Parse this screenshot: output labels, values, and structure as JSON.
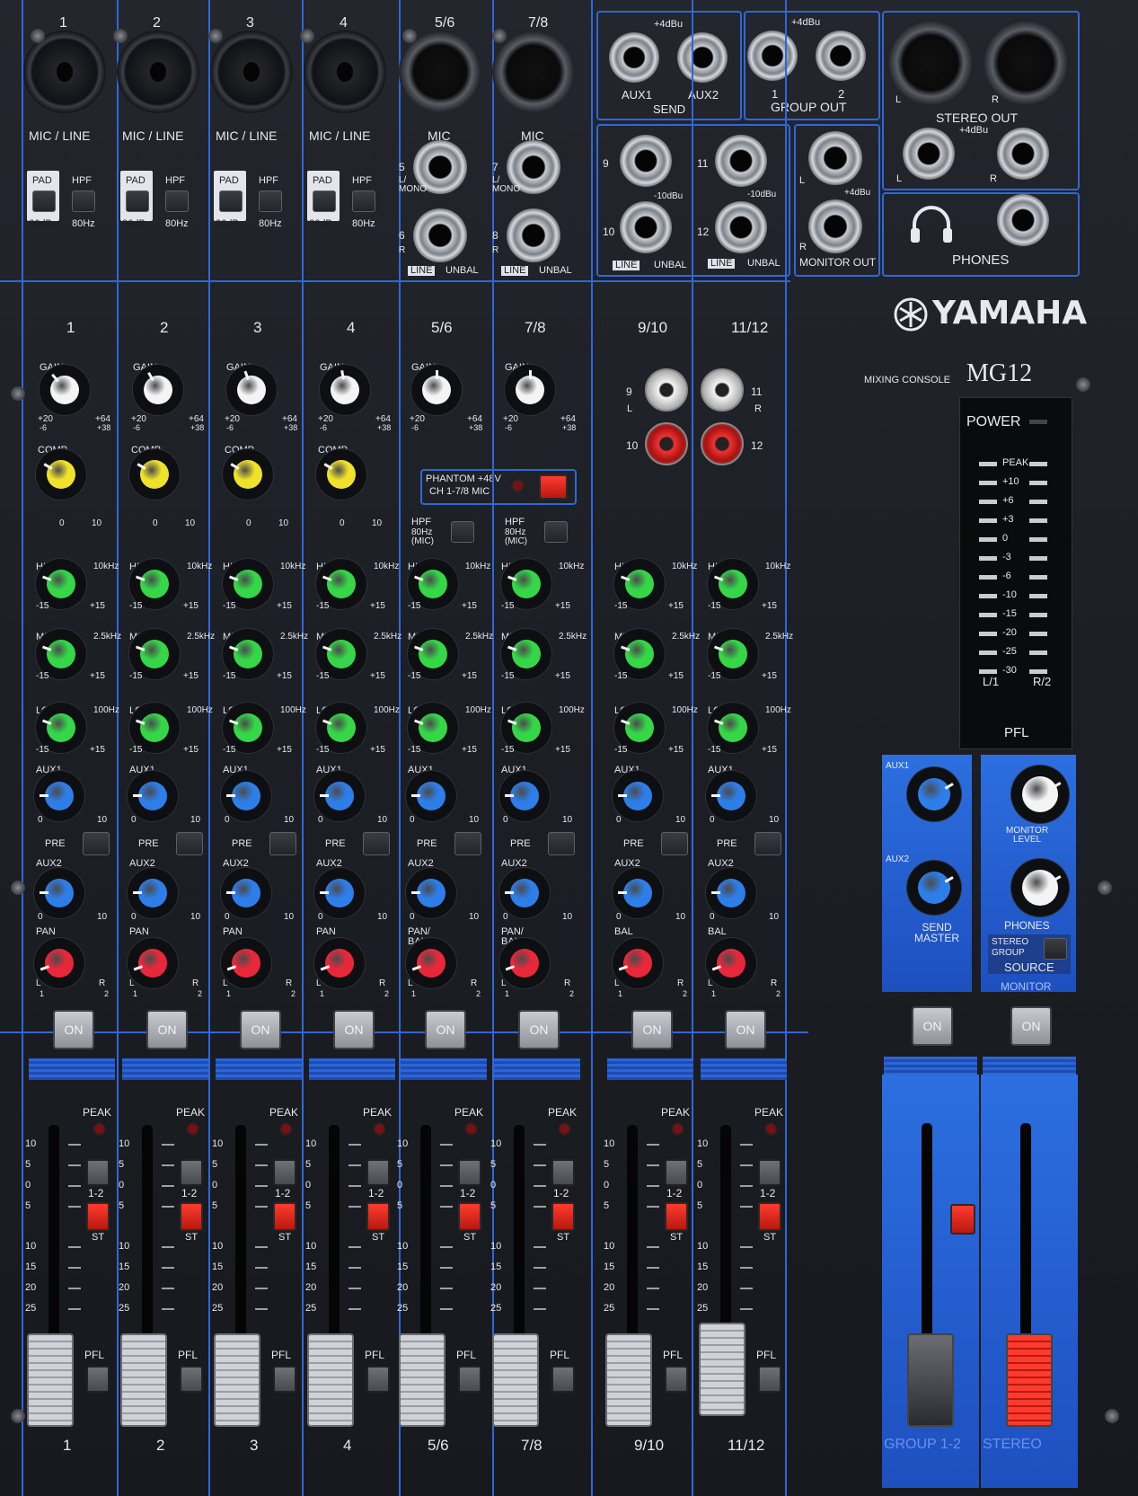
{
  "brand": {
    "logo": "YAMAHA",
    "model_prefix": "MIXING CONSOLE",
    "model": "MG12"
  },
  "top_inputs": {
    "channel_numbers": [
      "1",
      "2",
      "3",
      "4",
      "5/6",
      "7/8"
    ],
    "input_labels": [
      "MIC / LINE",
      "MIC / LINE",
      "MIC / LINE",
      "MIC / LINE",
      "MIC",
      "MIC"
    ],
    "pad_label": "PAD",
    "pad_value": "26dB",
    "hpf_label": "HPF",
    "hpf_value": "80Hz",
    "stereo_jacks": {
      "ch56": {
        "top_num": "5",
        "top_sub": "L/\nMONO",
        "bottom_num": "6",
        "bottom_sub": "R"
      },
      "ch78": {
        "top_num": "7",
        "top_sub": "L/\nMONO",
        "bottom_num": "8",
        "bottom_sub": "R"
      },
      "line": "LINE",
      "unbal": "UNBAL"
    }
  },
  "outputs": {
    "send_level": "+4dBu",
    "aux1": "AUX1",
    "aux2": "AUX2",
    "send": "SEND",
    "group_level": "+4dBu",
    "group1": "1",
    "group2": "2",
    "group_out": "GROUP OUT",
    "stereo_out": "STEREO OUT",
    "stereo_level": "+4dBu",
    "l": "L",
    "r": "R",
    "ch910": {
      "top": "9",
      "bottom": "10",
      "level": "-10dBu"
    },
    "ch1112": {
      "top": "11",
      "bottom": "12",
      "level": "-10dBu"
    },
    "monitor_out": "MONITOR OUT",
    "monitor_level": "+4dBu",
    "phones": "PHONES"
  },
  "channel_labels": [
    "1",
    "2",
    "3",
    "4",
    "5/6",
    "7/8",
    "9/10",
    "11/12"
  ],
  "knob_labels": {
    "gain": "GAIN",
    "gain_min": "+20",
    "gain_min2": "-6",
    "gain_max": "+64",
    "gain_max2": "+38",
    "comp": "COMP",
    "comp_min": "0",
    "comp_max": "10",
    "high": "HIGH",
    "high_freq": "10kHz",
    "mid": "MID",
    "mid_freq": "2.5kHz",
    "low": "LOW",
    "low_freq": "100Hz",
    "eq_min": "-15",
    "eq_max": "+15",
    "aux1": "AUX1",
    "aux2": "AUX2",
    "aux_min": "0",
    "aux_max": "10",
    "pre": "PRE",
    "pan": "PAN",
    "pan_bal": "PAN/\nBAL",
    "bal": "BAL",
    "pan_l": "L",
    "pan_r": "R",
    "pan_1": "1",
    "pan_2": "2"
  },
  "phantom": {
    "label": "PHANTOM +48V",
    "sub": "CH 1-7/8 MIC"
  },
  "hpf_stereo": {
    "label": "HPF",
    "sub": "80Hz\n(MIC)"
  },
  "rca": {
    "l_top": "9",
    "l_bot": "10",
    "r_top": "11",
    "r_bot": "12",
    "l": "L",
    "r": "R"
  },
  "meter": {
    "power": "POWER",
    "scale": [
      "PEAK",
      "+10",
      "+6",
      "+3",
      "0",
      "-3",
      "-6",
      "-10",
      "-15",
      "-20",
      "-25",
      "-30"
    ],
    "left": "L/1",
    "right": "R/2",
    "pfl": "PFL"
  },
  "master": {
    "aux1": "AUX1",
    "aux2": "AUX2",
    "send_master": "SEND\nMASTER",
    "monitor_level": "MONITOR\nLEVEL",
    "phones": "PHONES",
    "stereo": "STEREO",
    "group": "GROUP",
    "source": "SOURCE",
    "monitor": "MONITOR",
    "on": "ON"
  },
  "fader": {
    "peak": "PEAK",
    "scale": [
      "10",
      "5",
      "0",
      "5",
      "10",
      "15",
      "20",
      "25"
    ],
    "group_assign": "1-2",
    "stereo_assign": "ST",
    "pfl": "PFL",
    "on": "ON"
  },
  "fader_labels": [
    "1",
    "2",
    "3",
    "4",
    "5/6",
    "7/8",
    "9/10",
    "11/12",
    "GROUP 1-2",
    "STEREO"
  ],
  "colors": {
    "panel": "#1c1f25",
    "accent_blue": "#2f67d6",
    "knob_green": "#35d648",
    "knob_yellow": "#f0e22a",
    "knob_blue": "#2d7ee8",
    "knob_red": "#e8283a",
    "knob_white": "#f4f4f4"
  }
}
